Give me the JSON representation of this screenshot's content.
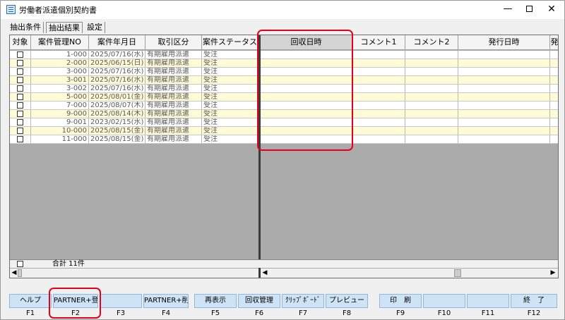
{
  "window": {
    "title": "労働者派遣個別契約書",
    "minimize": "—",
    "close": "✕"
  },
  "tabs": [
    {
      "label": "抽出条件"
    },
    {
      "label": "抽出結果"
    },
    {
      "label": "設定"
    }
  ],
  "grid": {
    "columns": [
      "対象",
      "案件管理NO",
      "案件年月日",
      "取引区分",
      "案件ステータス",
      "回収日時",
      "コメント1",
      "コメント2",
      "発行日時",
      "発"
    ],
    "rows": [
      {
        "no": "1-000",
        "date": "2025/07/16(水)",
        "kubun": "有期雇用派遣",
        "status": "受注"
      },
      {
        "no": "2-000",
        "date": "2025/06/15(日)",
        "kubun": "有期雇用派遣",
        "status": "受注"
      },
      {
        "no": "3-000",
        "date": "2025/07/16(水)",
        "kubun": "有期雇用派遣",
        "status": "受注"
      },
      {
        "no": "3-001",
        "date": "2025/07/16(水)",
        "kubun": "有期雇用派遣",
        "status": "受注"
      },
      {
        "no": "3-002",
        "date": "2025/07/16(水)",
        "kubun": "有期雇用派遣",
        "status": "受注"
      },
      {
        "no": "5-000",
        "date": "2025/08/01(金)",
        "kubun": "有期雇用派遣",
        "status": "受注"
      },
      {
        "no": "7-000",
        "date": "2025/08/07(木)",
        "kubun": "有期雇用派遣",
        "status": "受注"
      },
      {
        "no": "9-000",
        "date": "2025/08/14(木)",
        "kubun": "有期雇用派遣",
        "status": "受注"
      },
      {
        "no": "9-001",
        "date": "2023/02/15(水)",
        "kubun": "有期雇用派遣",
        "status": "受注"
      },
      {
        "no": "10-000",
        "date": "2025/08/15(金)",
        "kubun": "有期雇用派遣",
        "status": "受注"
      },
      {
        "no": "11-000",
        "date": "2025/08/15(金)",
        "kubun": "有期雇用派遣",
        "status": "受注"
      }
    ],
    "summary": "合計 11件"
  },
  "fkeys": [
    {
      "label": "ヘルプ",
      "key": "F1"
    },
    {
      "label": "PARTNER+登録",
      "key": "F2"
    },
    {
      "label": "",
      "key": "F3"
    },
    {
      "label": "PARTNER+削除",
      "key": "F4"
    },
    {
      "label": "再表示",
      "key": "F5"
    },
    {
      "label": "回収管理",
      "key": "F6"
    },
    {
      "label": "ｸﾘｯﾌﾟﾎﾞｰﾄﾞ",
      "key": "F7"
    },
    {
      "label": "プレビュー",
      "key": "F8"
    },
    {
      "label": "印　刷",
      "key": "F9"
    },
    {
      "label": "",
      "key": "F10"
    },
    {
      "label": "",
      "key": "F11"
    },
    {
      "label": "終　了",
      "key": "F12"
    }
  ],
  "colors": {
    "row_alt": "#fffbd6",
    "row_base": "#ffffff",
    "fkey_bg": "#cfe3f7",
    "highlight": "#e3001b"
  }
}
